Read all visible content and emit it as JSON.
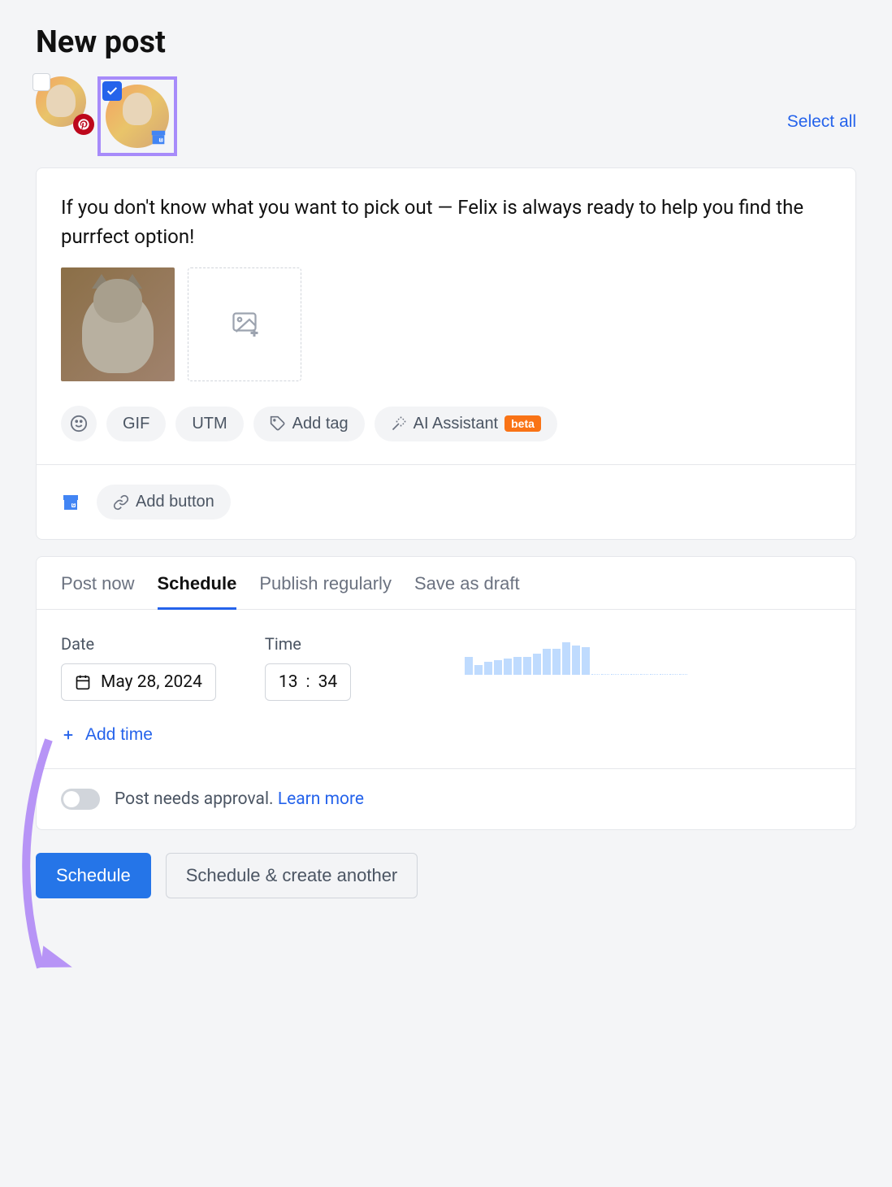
{
  "page_title": "New post",
  "accounts": {
    "select_all_label": "Select all"
  },
  "post": {
    "text": "If you don't know what you want to pick out — Felix is always ready to help you find the purrfect option!"
  },
  "toolbar": {
    "gif_label": "GIF",
    "utm_label": "UTM",
    "add_tag_label": "Add tag",
    "ai_assistant_label": "AI Assistant",
    "beta_label": "beta"
  },
  "add_button_label": "Add button",
  "tabs": {
    "post_now": "Post now",
    "schedule": "Schedule",
    "publish_regularly": "Publish regularly",
    "save_as_draft": "Save as draft"
  },
  "schedule": {
    "date_label": "Date",
    "time_label": "Time",
    "date_value": "May 28, 2024",
    "time_hour": "13",
    "time_separator": ":",
    "time_minute": "34",
    "add_time_label": "Add time"
  },
  "approval": {
    "text": "Post needs approval.",
    "learn_more": "Learn more"
  },
  "actions": {
    "schedule": "Schedule",
    "schedule_another": "Schedule & create another"
  },
  "chart_data": {
    "type": "bar",
    "values": [
      22,
      12,
      16,
      18,
      20,
      22,
      22,
      26,
      32,
      32,
      40,
      36,
      34,
      2,
      2,
      2,
      2,
      2,
      2,
      2,
      2,
      2,
      2
    ]
  }
}
